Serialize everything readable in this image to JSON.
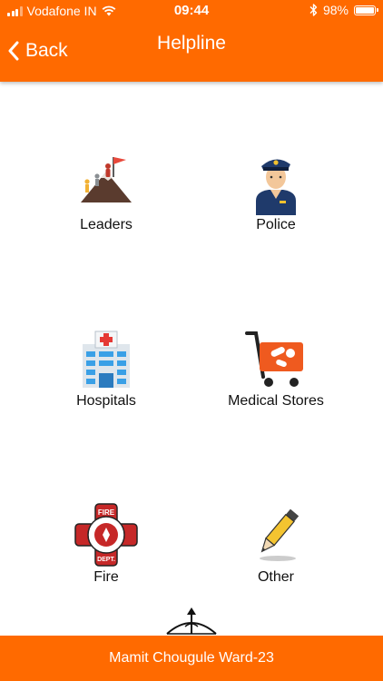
{
  "status": {
    "carrier": "Vodafone IN",
    "time": "09:44",
    "battery": "98%",
    "battery_level": 0.98
  },
  "header": {
    "back_label": "Back",
    "title": "Helpline"
  },
  "items": [
    {
      "label": "Leaders",
      "icon": "leaders-icon"
    },
    {
      "label": "Police",
      "icon": "police-icon"
    },
    {
      "label": "Hospitals",
      "icon": "hospital-icon"
    },
    {
      "label": "Medical Stores",
      "icon": "medical-store-icon"
    },
    {
      "label": "Fire",
      "icon": "fire-dept-icon"
    },
    {
      "label": "Other",
      "icon": "pencil-icon"
    }
  ],
  "footer": {
    "text": "Mamit Chougule Ward-23"
  },
  "colors": {
    "accent": "#ff6a00"
  }
}
